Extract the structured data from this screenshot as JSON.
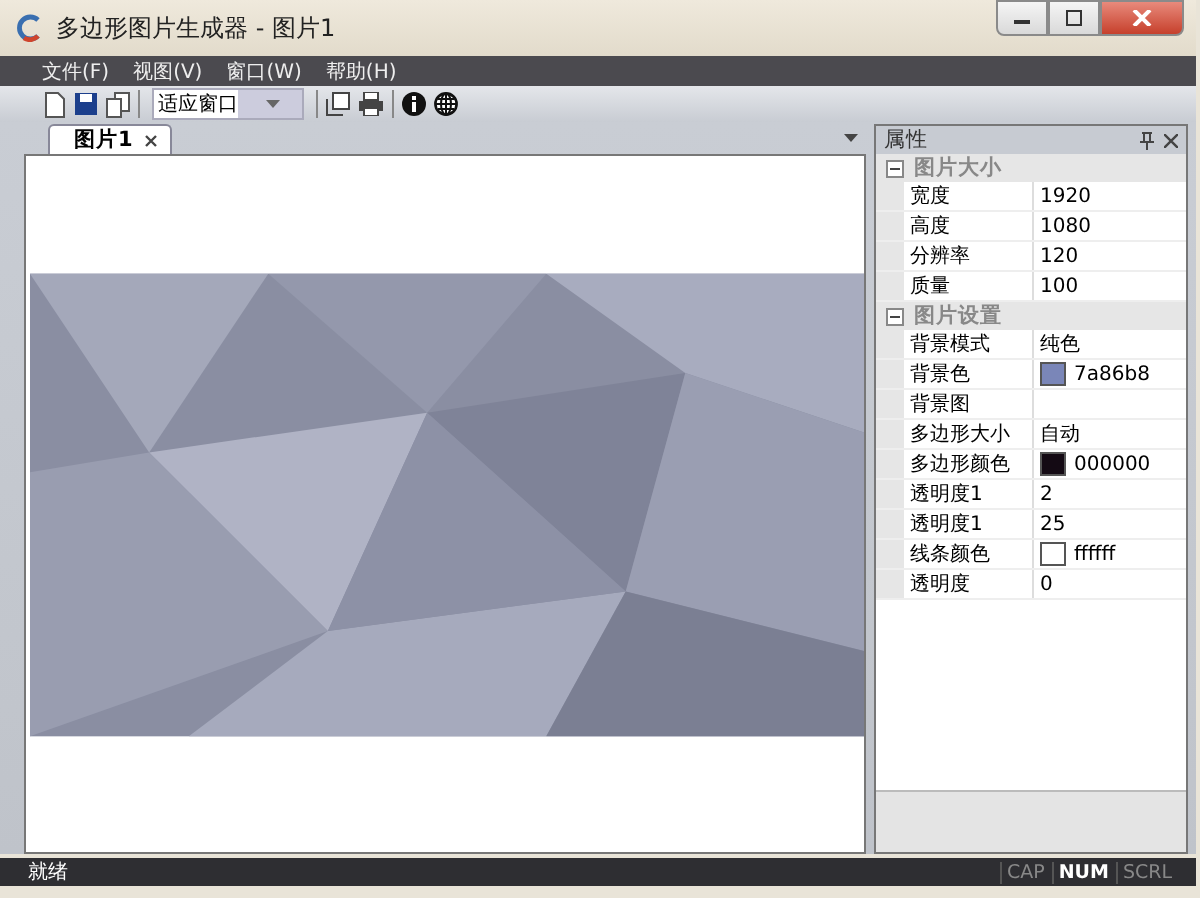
{
  "window": {
    "title": "多边形图片生成器 - 图片1"
  },
  "menu": [
    "文件(F)",
    "视图(V)",
    "窗口(W)",
    "帮助(H)"
  ],
  "toolbar": {
    "zoom_select": {
      "value": "适应窗口"
    }
  },
  "tabs": [
    {
      "label": "图片1",
      "selected": true
    }
  ],
  "properties": {
    "title": "属性",
    "groups": [
      {
        "label": "图片大小",
        "expanded": true,
        "rows": [
          {
            "name": "宽度",
            "value": "1920"
          },
          {
            "name": "高度",
            "value": "1080"
          },
          {
            "name": "分辨率",
            "value": "120"
          },
          {
            "name": "质量",
            "value": "100"
          }
        ]
      },
      {
        "label": "图片设置",
        "expanded": true,
        "rows": [
          {
            "name": "背景模式",
            "value": "纯色"
          },
          {
            "name": "背景色",
            "value": "7a86b8",
            "color": "#7a86b8"
          },
          {
            "name": "背景图"
          },
          {
            "name": "多边形大小",
            "value": "自动"
          },
          {
            "name": "多边形颜色",
            "value": "000000",
            "color": "#140a14"
          },
          {
            "name": "透明度1",
            "value": "2"
          },
          {
            "name": "透明度1",
            "value": "25"
          },
          {
            "name": "线条颜色",
            "value": "ffffff",
            "color": "#ffffff"
          },
          {
            "name": "透明度",
            "value": "0"
          }
        ]
      }
    ]
  },
  "status_bar": {
    "text": "就绪",
    "indicators": [
      {
        "label": "CAP",
        "on": false
      },
      {
        "label": "NUM",
        "on": true
      },
      {
        "label": "SCRL",
        "on": false
      }
    ]
  }
}
